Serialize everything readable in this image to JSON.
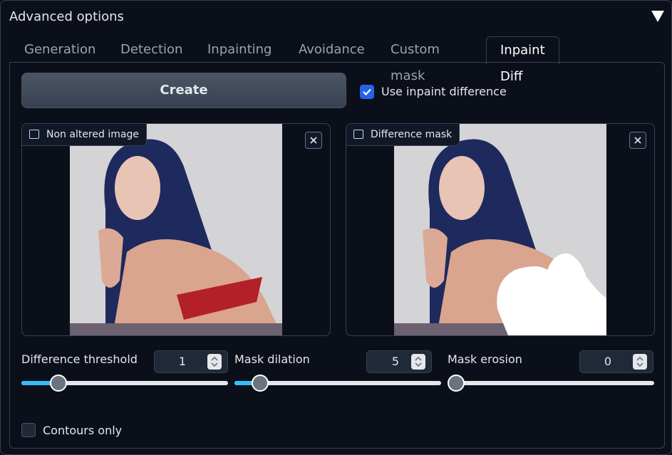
{
  "panel": {
    "title": "Advanced options"
  },
  "tabs": [
    {
      "label": "Generation"
    },
    {
      "label": "Detection"
    },
    {
      "label": "Inpainting"
    },
    {
      "label": "Avoidance"
    },
    {
      "label": "Custom mask"
    },
    {
      "label": "Inpaint Diff"
    }
  ],
  "active_tab": "Inpaint Diff",
  "create_button": {
    "label": "Create"
  },
  "use_inpaint_difference": {
    "label": "Use inpaint difference",
    "checked": true
  },
  "non_altered_image": {
    "label": "Non altered image"
  },
  "difference_mask": {
    "label": "Difference mask"
  },
  "sliders": {
    "difference_threshold": {
      "label": "Difference threshold",
      "value": "1",
      "fraction": 0.15
    },
    "mask_dilation": {
      "label": "Mask dilation",
      "value": "5",
      "fraction": 0.09
    },
    "mask_erosion": {
      "label": "Mask erosion",
      "value": "0",
      "fraction": 0.0
    }
  },
  "contours_only": {
    "label": "Contours only",
    "checked": false
  },
  "colors": {
    "accent": "#2563eb",
    "slider_fill": "#38bdf8",
    "background": "#0b0f19"
  }
}
